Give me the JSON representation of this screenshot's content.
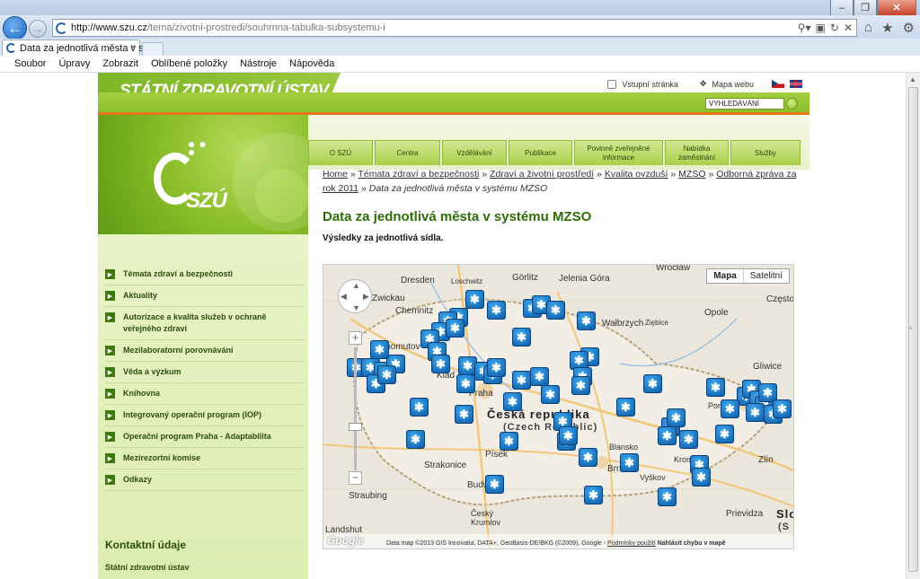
{
  "browser": {
    "url_host": "http://www.szu.cz",
    "url_path": "/tema/zivotni-prostredi/souhrnna-tabulka-subsystemu-i",
    "tab_title": "Data za jednotlivá města v s...",
    "tab_close": "×",
    "menu": [
      "Soubor",
      "Úpravy",
      "Zobrazit",
      "Oblíbené položky",
      "Nástroje",
      "Nápověda"
    ],
    "icons": [
      "back-icon",
      "forward-icon",
      "search-icon",
      "refresh-icon",
      "stop-icon",
      "home-icon",
      "star-icon",
      "gear-icon"
    ]
  },
  "header": {
    "title": "STÁTNÍ ZDRAVOTNÍ ÚSTAV",
    "link_home": "Vstupní stránka",
    "link_sitemap": "Mapa webu",
    "search_placeholder": "VYHLEDÁVÁNÍ",
    "logo_text": "SZÚ"
  },
  "nav": [
    "O SZÚ",
    "Centra",
    "Vzdělávání",
    "Publikace",
    "Povinně zveřejněné informace",
    "Nabídka zaměstnání",
    "Služby"
  ],
  "sidebar": {
    "items": [
      "Témata zdraví a bezpečnosti",
      "Aktuality",
      "Autorizace a kvalita služeb v ochraně veřejného zdraví",
      "Mezilaboratorní porovnávání",
      "Věda a výzkum",
      "Knihovna",
      "Integrovaný operační program (IOP)",
      "Operační program Praha - Adaptabilita",
      "Mezirezortní komise",
      "Odkazy"
    ],
    "contact_heading": "Kontaktní údaje",
    "contact_name": "Státní zdravotní ústav"
  },
  "breadcrumb": {
    "links": [
      "Home",
      "Témata zdraví a bezpečnosti",
      "Zdraví a životní prostředí",
      "Kvalita ovzduší",
      "MZSO",
      "Odborná zpráva za rok 2011"
    ],
    "current": "Data za jednotlivá města v systému MZSO",
    "separator": "»"
  },
  "main": {
    "title": "Data za jednotlivá města v systému MZSO",
    "subtitle": "Výsledky za jednotlivá sídla."
  },
  "map": {
    "type_map": "Mapa",
    "type_satellite": "Satelitní",
    "attribution": "Data map ©2013 GIS Innovatia, DATA+, GeoBasis-DE/BKG (©2009), Google -",
    "terms": "Podmínky použití",
    "report": "Nahlásit chybu v mapě",
    "google": "Google",
    "country_label": "Česká republika",
    "country_sub": "(Czech Republic)",
    "places": [
      "Wrocław",
      "Dresden",
      "Loschwitz",
      "Görlitz",
      "Jelenia Góra",
      "Chemnitz",
      "Wałbrzych",
      "Często",
      "Zwickau",
      "Opole",
      "Ziębice",
      "Chomutov",
      "Gliwice",
      "Klad",
      "Praha",
      "Poruba",
      "Strakonice",
      "Písek",
      "Blansko",
      "Kroměříž",
      "Brno",
      "Zlín",
      "Straubing",
      "Budweis",
      "Český Krumlov",
      "Vyškov",
      "Prievidza",
      "Landshut",
      "Slo",
      "(S"
    ],
    "marker_glyph": "✱",
    "marker_count": 65
  },
  "colors": {
    "brand_green": "#8cbd2a",
    "accent_orange": "#e77817",
    "title_green": "#2f6c05",
    "marker_blue": "#0b5ba7"
  }
}
